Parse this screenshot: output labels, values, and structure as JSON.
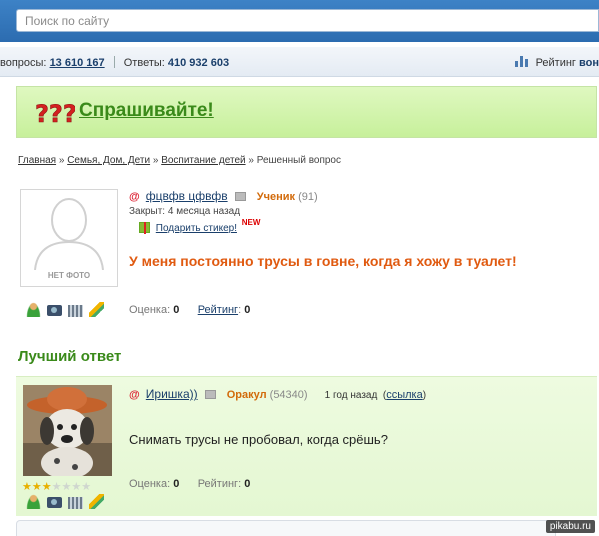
{
  "search": {
    "placeholder": "Поиск по сайту"
  },
  "stats": {
    "questions_label": "вопросы:",
    "questions_count": "13 610 167",
    "answers_label": "Ответы:",
    "answers_count": "410 932 603",
    "rating_label": "Рейтинг",
    "rating_tail": "вон"
  },
  "banner": {
    "label": "Спрашивайте!"
  },
  "breadcrumbs": {
    "items": [
      "Главная",
      "Семья, Дом, Дети",
      "Воспитание детей"
    ],
    "separator": "»",
    "current": "Решенный вопрос"
  },
  "question": {
    "avatar_label": "НЕТ ФОТО",
    "author": "фцвфв цфвфв",
    "rank": "Ученик",
    "rank_points": "(91)",
    "closed": "Закрыт: 4 месяца назад",
    "gift_link": "Подарить стикер!",
    "new_badge": "NEW",
    "title": "У меня постоянно трусы в говне, когда я хожу в туалет!",
    "score_label": "Оценка:",
    "score_value": "0",
    "rating_label": "Рейтинг",
    "rating_value": "0"
  },
  "best_answer": {
    "heading": "Лучший ответ",
    "author": "Иришка))",
    "rank": "Оракул",
    "rank_points": "(54340)",
    "time_ago": "1 год назад",
    "link_label": "ссылка",
    "text": "Снимать трусы не пробовал, когда срёшь?",
    "stars": {
      "filled": 3,
      "total": 7
    },
    "score_label": "Оценка:",
    "score_value": "0",
    "rating_label": "Рейтинг:",
    "rating_value": "0"
  },
  "watermark": "pikabu.ru",
  "colors": {
    "header_blue": "#2c6cb0",
    "banner_green": "#c7f09b",
    "rank_orange": "#d26a0a",
    "title_orange": "#e05a10",
    "heading_green": "#3a8a1a"
  }
}
